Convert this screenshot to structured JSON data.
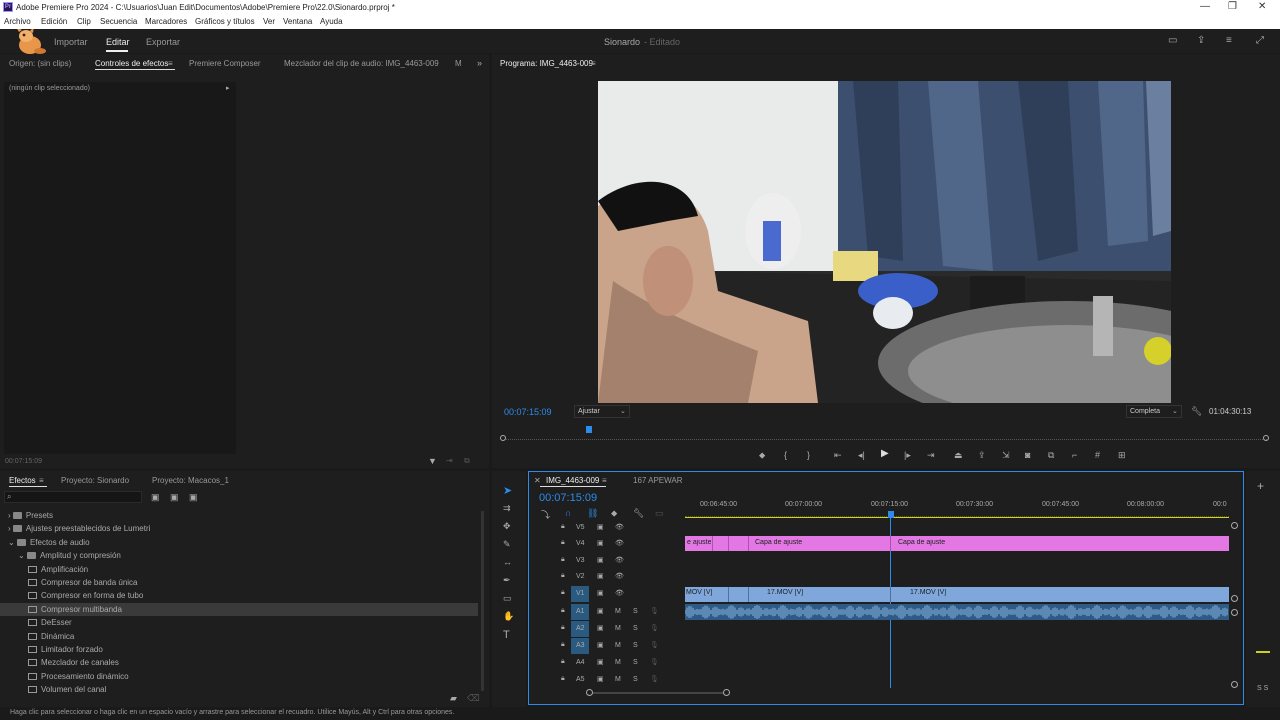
{
  "window": {
    "title": "Adobe Premiere Pro 2024 - C:\\Usuarios\\Juan Edit\\Documentos\\Adobe\\Premiere Pro\\22.0\\Sionardo.prproj *",
    "app_icon": "Pr"
  },
  "menu": [
    "Archivo",
    "Edición",
    "Clip",
    "Secuencia",
    "Marcadores",
    "Gráficos y títulos",
    "Ver",
    "Ventana",
    "Ayuda"
  ],
  "header": {
    "tabs": [
      "Importar",
      "Editar",
      "Exportar"
    ],
    "active_tab": "Editar",
    "project_name": "Sionardo",
    "project_state": "- Editado"
  },
  "source_panel": {
    "tabs": [
      "Origen: (sin clips)",
      "Controles de efectos",
      "Premiere Composer",
      "Mezclador del clip de audio: IMG_4463-009",
      "M"
    ],
    "no_clip": "(ningún clip seleccionado)",
    "timecode": "00:07:15:09"
  },
  "program_monitor": {
    "tab": "Programa: IMG_4463-009",
    "timecode": "00:07:15:09",
    "fit": "Ajustar",
    "quality": "Completa",
    "duration": "01:04:30:13",
    "playhead_fraction": 0.107
  },
  "effects_panel": {
    "tabs": [
      "Efectos",
      "Proyecto: Sionardo",
      "Proyecto: Macacos_1"
    ],
    "tree": [
      {
        "label": "Presets",
        "level": 0,
        "kind": "folder"
      },
      {
        "label": "Ajustes preestablecidos de Lumetri",
        "level": 0,
        "kind": "folder"
      },
      {
        "label": "Efectos de audio",
        "level": 0,
        "kind": "folder",
        "open": true
      },
      {
        "label": "Amplitud y compresión",
        "level": 1,
        "kind": "folder",
        "open": true
      },
      {
        "label": "Amplificación",
        "level": 2,
        "kind": "fx"
      },
      {
        "label": "Compresor de banda única",
        "level": 2,
        "kind": "fx"
      },
      {
        "label": "Compresor en forma de tubo",
        "level": 2,
        "kind": "fx"
      },
      {
        "label": "Compresor multibanda",
        "level": 2,
        "kind": "fx",
        "selected": true
      },
      {
        "label": "DeEsser",
        "level": 2,
        "kind": "fx"
      },
      {
        "label": "Dinámica",
        "level": 2,
        "kind": "fx"
      },
      {
        "label": "Limitador forzado",
        "level": 2,
        "kind": "fx"
      },
      {
        "label": "Mezclador de canales",
        "level": 2,
        "kind": "fx"
      },
      {
        "label": "Procesamiento dinámico",
        "level": 2,
        "kind": "fx"
      },
      {
        "label": "Volumen del canal",
        "level": 2,
        "kind": "fx"
      }
    ]
  },
  "timeline": {
    "tabs": [
      "IMG_4463-009",
      "167 APEWAR"
    ],
    "timecode": "00:07:15:09",
    "ruler": [
      "00:06:45:00",
      "00:07:00:00",
      "00:07:15:00",
      "00:07:30:00",
      "00:07:45:00",
      "00:08:00:00",
      "00:0"
    ],
    "video_tracks": [
      "V5",
      "V4",
      "V3",
      "V2",
      "V1"
    ],
    "audio_tracks": [
      "A1",
      "A2",
      "A3",
      "A4",
      "A5"
    ],
    "clips": {
      "v4": [
        {
          "label": "e ajuste"
        },
        {
          "label": "Capa de ajuste"
        },
        {
          "label": "Capa de ajuste"
        }
      ],
      "v1": [
        {
          "label": "MOV [V]"
        },
        {
          "label": "17.MOV [V]"
        },
        {
          "label": "17.MOV [V]"
        }
      ]
    },
    "audio_meter": "S S"
  },
  "status_bar": "Haga clic para seleccionar o haga clic en un espacio vacío y arrastre para seleccionar el recuadro. Utilice Mayús, Alt y Ctrl para otras opciones.",
  "colors": {
    "accent": "#2d8ceb",
    "adjustment_clip": "#e377e3",
    "video_clip": "#7fa7dc",
    "audio_clip": "#3d6a96"
  }
}
